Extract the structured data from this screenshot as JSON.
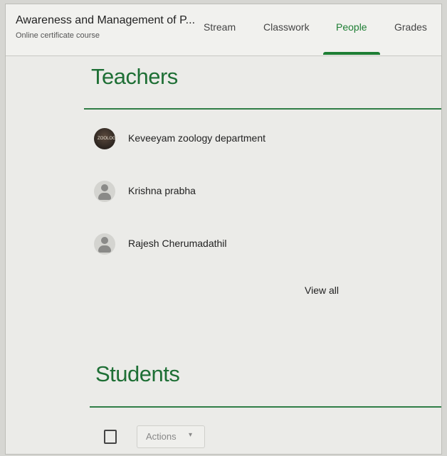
{
  "header": {
    "title": "Awareness and Management of P...",
    "subtitle": "Online certificate course",
    "tabs": [
      {
        "label": "Stream"
      },
      {
        "label": "Classwork"
      },
      {
        "label": "People",
        "active": true
      },
      {
        "label": "Grades"
      }
    ]
  },
  "teachers": {
    "heading": "Teachers",
    "list": [
      {
        "name": "Keveeyam zoology department",
        "avatar_text": "ZOOLOGY"
      },
      {
        "name": "Krishna prabha"
      },
      {
        "name": "Rajesh Cherumadathil"
      }
    ],
    "view_all": "View all"
  },
  "students": {
    "heading": "Students",
    "actions_label": "Actions",
    "actions_caret": "▾"
  },
  "colors": {
    "accent_green": "#1e7e34",
    "heading_green": "#1e6f35"
  }
}
